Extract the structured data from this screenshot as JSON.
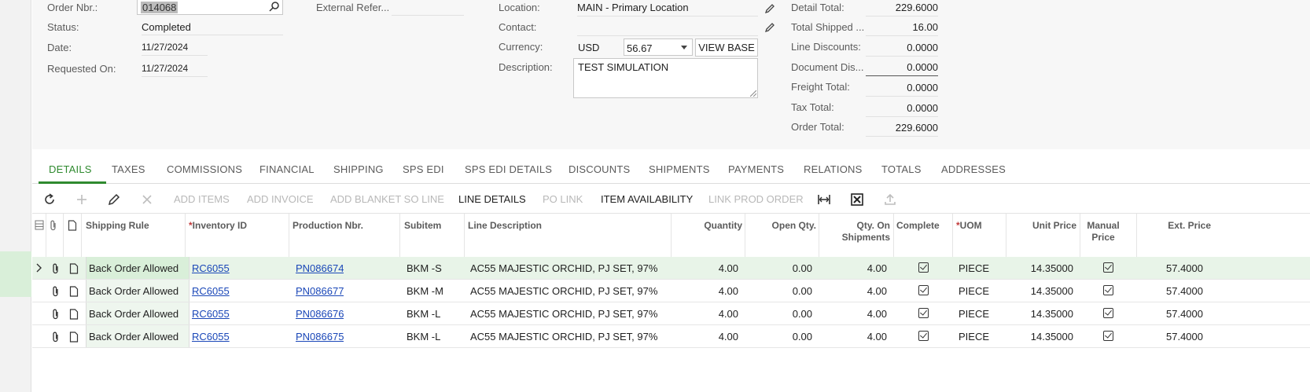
{
  "header": {
    "order_nbr_label": "Order Nbr.:",
    "order_nbr_value": "014068",
    "status_label": "Status:",
    "status_value": "Completed",
    "date_label": "Date:",
    "date_value": "11/27/2024",
    "requested_on_label": "Requested On:",
    "requested_on_value": "11/27/2024",
    "external_ref_label": "External Refer...",
    "external_ref_value": "",
    "location_label": "Location:",
    "location_value": "MAIN - Primary Location",
    "contact_label": "Contact:",
    "contact_value": "",
    "currency_label": "Currency:",
    "currency_code": "USD",
    "currency_rate": "56.67",
    "view_base_label": "VIEW BASE",
    "description_label": "Description:",
    "description_value": "TEST SIMULATION"
  },
  "totals": {
    "detail_total_label": "Detail Total:",
    "detail_total_value": "229.6000",
    "total_shipped_label": "Total Shipped ...",
    "total_shipped_value": "16.00",
    "line_discounts_label": "Line Discounts:",
    "line_discounts_value": "0.0000",
    "document_dis_label": "Document Dis...",
    "document_dis_value": "0.0000",
    "freight_total_label": "Freight Total:",
    "freight_total_value": "0.0000",
    "tax_total_label": "Tax Total:",
    "tax_total_value": "0.0000",
    "order_total_label": "Order Total:",
    "order_total_value": "229.6000"
  },
  "tabs": [
    "DETAILS",
    "TAXES",
    "COMMISSIONS",
    "FINANCIAL",
    "SHIPPING",
    "SPS EDI",
    "SPS EDI DETAILS",
    "DISCOUNTS",
    "SHIPMENTS",
    "PAYMENTS",
    "RELATIONS",
    "TOTALS",
    "ADDRESSES"
  ],
  "toolbar": {
    "add_items": "ADD ITEMS",
    "add_invoice": "ADD INVOICE",
    "add_blanket": "ADD BLANKET SO LINE",
    "line_details": "LINE DETAILS",
    "po_link": "PO LINK",
    "item_availability": "ITEM AVAILABILITY",
    "link_prod_order": "LINK PROD ORDER"
  },
  "columns": {
    "shipping_rule": "Shipping Rule",
    "inventory_id": "Inventory ID",
    "production_nbr": "Production Nbr.",
    "subitem": "Subitem",
    "line_description": "Line Description",
    "quantity": "Quantity",
    "open_qty": "Open Qty.",
    "qty_on_shipments_1": "Qty. On",
    "qty_on_shipments_2": "Shipments",
    "completed": "Complete",
    "uom": "UOM",
    "unit_price": "Unit Price",
    "manual_price_1": "Manual",
    "manual_price_2": "Price",
    "ext_price": "Ext. Price"
  },
  "rows": [
    {
      "shipping_rule": "Back Order Allowed",
      "inventory_id": "RC6055",
      "production_nbr": "PN086674",
      "subitem": "BKM -S",
      "description": "AC55 MAJESTIC ORCHID, PJ SET, 97% ...",
      "quantity": "4.00",
      "open_qty": "0.00",
      "qty_on_shipments": "4.00",
      "uom": "PIECE",
      "unit_price": "14.35000",
      "ext_price": "57.4000"
    },
    {
      "shipping_rule": "Back Order Allowed",
      "inventory_id": "RC6055",
      "production_nbr": "PN086677",
      "subitem": "BKM -M",
      "description": "AC55 MAJESTIC ORCHID, PJ SET, 97% ...",
      "quantity": "4.00",
      "open_qty": "0.00",
      "qty_on_shipments": "4.00",
      "uom": "PIECE",
      "unit_price": "14.35000",
      "ext_price": "57.4000"
    },
    {
      "shipping_rule": "Back Order Allowed",
      "inventory_id": "RC6055",
      "production_nbr": "PN086676",
      "subitem": "BKM -L",
      "description": "AC55 MAJESTIC ORCHID, PJ SET, 97% ...",
      "quantity": "4.00",
      "open_qty": "0.00",
      "qty_on_shipments": "4.00",
      "uom": "PIECE",
      "unit_price": "14.35000",
      "ext_price": "57.4000"
    },
    {
      "shipping_rule": "Back Order Allowed",
      "inventory_id": "RC6055",
      "production_nbr": "PN086675",
      "subitem": "BKM -L",
      "description": "AC55 MAJESTIC ORCHID, PJ SET, 97% ...",
      "quantity": "4.00",
      "open_qty": "0.00",
      "qty_on_shipments": "4.00",
      "uom": "PIECE",
      "unit_price": "14.35000",
      "ext_price": "57.4000"
    }
  ],
  "colors": {
    "accent": "#2f8a2f",
    "link": "#1a47b8",
    "selected_row": "#e8f4e8"
  },
  "icons": [
    "search-icon",
    "pencil-icon",
    "dropdown-arrow-icon",
    "refresh-icon",
    "plus-icon",
    "delete-icon",
    "fit-columns-icon",
    "export-excel-icon",
    "upload-icon",
    "attachment-icon",
    "note-icon",
    "expand-chevron-icon",
    "checkbox-checked-icon"
  ]
}
